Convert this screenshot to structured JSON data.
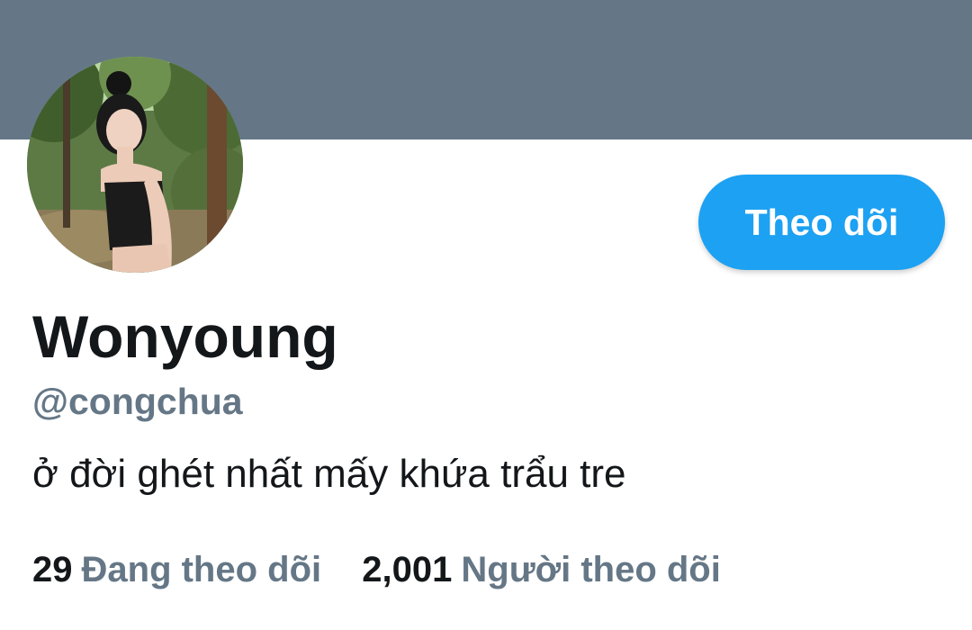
{
  "profile": {
    "display_name": "Wonyoung",
    "handle": "@congchua",
    "bio": "ở đời ghét nhất mấy khứa trẩu tre",
    "follow_button_label": "Theo dõi"
  },
  "stats": {
    "following": {
      "count": "29",
      "label": "Đang theo dõi"
    },
    "followers": {
      "count": "2,001",
      "label": "Người theo dõi"
    }
  },
  "colors": {
    "banner": "#657786",
    "accent": "#1da1f2",
    "primary_text": "#14171a",
    "secondary_text": "#657786"
  }
}
